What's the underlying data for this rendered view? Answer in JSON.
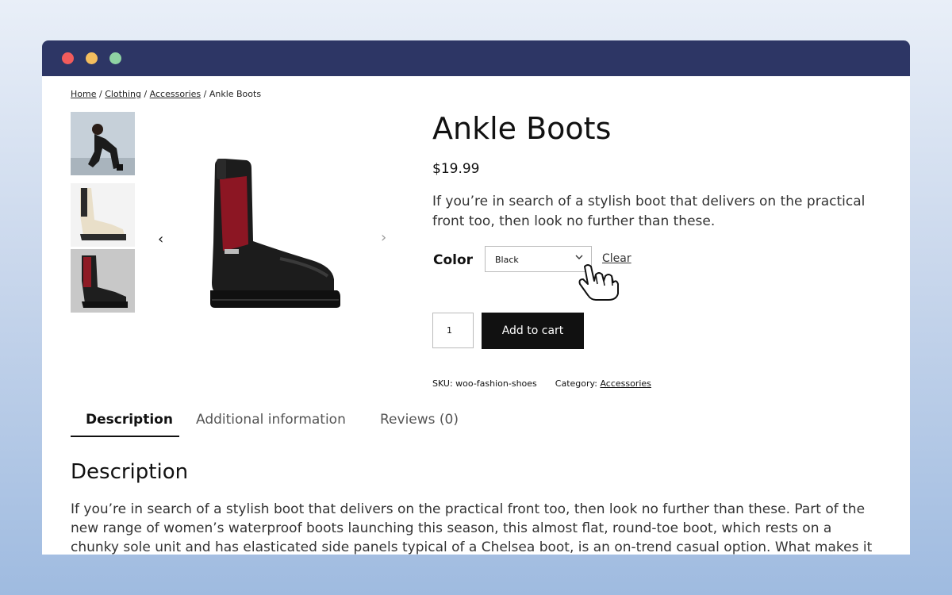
{
  "window": {
    "controls": [
      "close",
      "minimize",
      "maximize"
    ],
    "colors": {
      "titlebar": "#2d3665",
      "close": "#f25c5c",
      "minimize": "#f4be5e",
      "maximize": "#8fd3a3"
    }
  },
  "breadcrumb": {
    "items": [
      "Home",
      "Clothing",
      "Accessories"
    ],
    "separator": " / ",
    "current": "Ankle Boots"
  },
  "gallery": {
    "thumbnails": [
      "model-photo",
      "cream-boot-photo",
      "black-red-boot-photo"
    ],
    "prev_icon": "‹",
    "next_icon": "›"
  },
  "product": {
    "title": "Ankle Boots",
    "price": "$19.99",
    "short_description": "If you’re in search of a stylish boot that delivers on the practical front too, then look no further than these.",
    "color_label": "Color",
    "color_selected": "Black",
    "clear_label": "Clear",
    "quantity": "1",
    "add_to_cart_label": "Add to cart",
    "sku_label": "SKU:",
    "sku_value": "woo-fashion-shoes",
    "category_label": "Category:",
    "category_value": "Accessories"
  },
  "tabs": [
    {
      "label": "Description",
      "active": true
    },
    {
      "label": "Additional information",
      "active": false
    },
    {
      "label": "Reviews (0)",
      "active": false
    }
  ],
  "description": {
    "heading": "Description",
    "body": "If you’re in search of a stylish boot that delivers on the practical front too, then look no further than these. Part of the new range of women’s waterproof boots launching this season, this almost flat, round-toe boot, which rests on a chunky sole unit and has elasticated side panels typical of a Chelsea boot, is an on-trend casual option. What makes it highly practical, especially on wet"
  }
}
